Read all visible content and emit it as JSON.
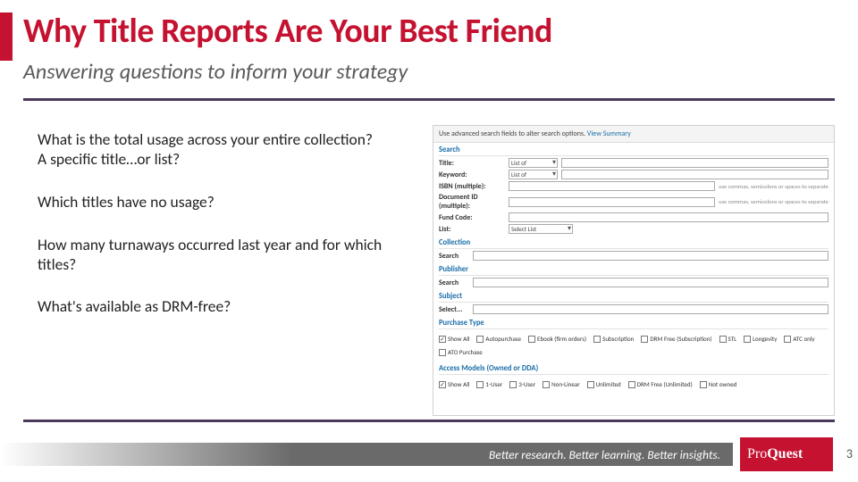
{
  "slide": {
    "title": "Why Title Reports Are Your Best Friend",
    "subtitle": "Answering questions to inform your strategy"
  },
  "bullets": {
    "b1a": "What is the total usage across your entire collection?",
    "b1b": "A specific title…or list?",
    "b2": "Which titles have no usage?",
    "b3": "How many turnaways occurred last year and for which titles?",
    "b4": "What's available as DRM-free?"
  },
  "panel": {
    "topbar_text": "Use advanced search fields to alter search options.",
    "topbar_link": "View Summary",
    "search": {
      "heading": "Search",
      "title_label": "Title:",
      "title_mode": "List of",
      "keyword_label": "Keyword:",
      "keyword_mode": "List of",
      "isbn_label": "ISBN (multiple):",
      "isbn_hint": "use commas, semicolons or spaces to separate",
      "docid_label": "Document ID (multiple):",
      "docid_hint": "use commas, semicolons or spaces to separate",
      "fund_label": "Fund Code:",
      "list_label": "List:",
      "list_value": "Select List"
    },
    "collection": {
      "heading": "Collection",
      "search_label": "Search"
    },
    "publisher": {
      "heading": "Publisher",
      "search_label": "Search"
    },
    "subject": {
      "heading": "Subject",
      "select_label": "Select..."
    },
    "purchase": {
      "heading": "Purchase Type",
      "show_all": "Show All",
      "autopurchase": "Autopurchase",
      "ebook_fl": "Ebook (firm orders)",
      "subscription": "Subscription",
      "drm_free_sub": "DRM Free (Subscription)",
      "stl": "STL",
      "longevity": "Longevity",
      "atc_only": "ATC only",
      "ato_purchase": "ATO Purchase"
    },
    "access": {
      "heading": "Access Models (Owned or DDA)",
      "show_all": "Show All",
      "one_user": "1-User",
      "three_user": "3-User",
      "non_linear": "Non-Linear",
      "unlimited": "Unlimited",
      "drm_free_unl": "DRM Free (Unlimited)",
      "not_owned": "Not owned"
    }
  },
  "footer": {
    "tagline": "Better research. Better learning. Better insights.",
    "logo": "ProQuest",
    "page": "3"
  }
}
